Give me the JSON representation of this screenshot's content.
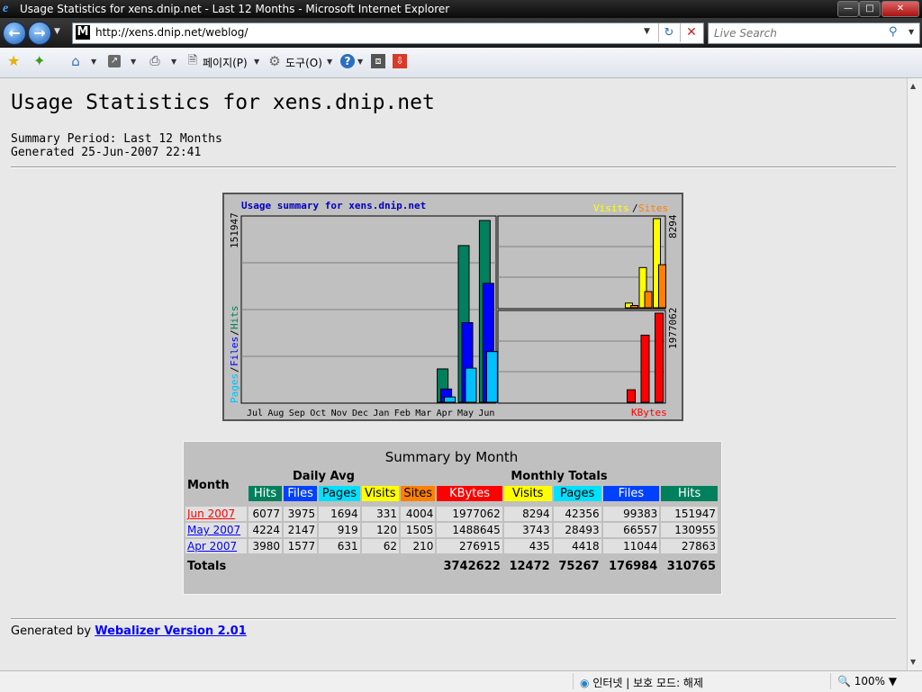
{
  "window": {
    "title": "Usage Statistics for xens.dnip.net - Last 12 Months - Microsoft Internet Explorer"
  },
  "addressbar": {
    "url": "http://xens.dnip.net/weblog/",
    "search_placeholder": "Live Search"
  },
  "commandbar": {
    "page_label": "페이지(P)",
    "tools_label": "도구(O)"
  },
  "page": {
    "heading": "Usage Statistics for xens.dnip.net",
    "summary_period": "Summary Period: Last 12 Months",
    "generated": "Generated 25-Jun-2007 22:41",
    "footer_prefix": "Generated by",
    "footer_link": "Webalizer Version 2.01"
  },
  "chart_data": {
    "type": "bar",
    "title": "Usage summary for xens.dnip.net",
    "categories": [
      "Jul",
      "Aug",
      "Sep",
      "Oct",
      "Nov",
      "Dec",
      "Jan",
      "Feb",
      "Mar",
      "Apr",
      "May",
      "Jun"
    ],
    "series": [
      {
        "name": "Hits",
        "color": "#00805c",
        "values": [
          0,
          0,
          0,
          0,
          0,
          0,
          0,
          0,
          0,
          27863,
          130955,
          151947
        ]
      },
      {
        "name": "Files",
        "color": "#0000ff",
        "values": [
          0,
          0,
          0,
          0,
          0,
          0,
          0,
          0,
          0,
          11044,
          66557,
          99383
        ]
      },
      {
        "name": "Pages",
        "color": "#00c0ff",
        "values": [
          0,
          0,
          0,
          0,
          0,
          0,
          0,
          0,
          0,
          4418,
          28493,
          42356
        ]
      },
      {
        "name": "Visits",
        "color": "#ffff00",
        "values": [
          0,
          0,
          0,
          0,
          0,
          0,
          0,
          0,
          0,
          435,
          3743,
          8294
        ]
      },
      {
        "name": "Sites",
        "color": "#ff8000",
        "values": [
          0,
          0,
          0,
          0,
          0,
          0,
          0,
          0,
          0,
          210,
          1505,
          4004
        ]
      },
      {
        "name": "KBytes",
        "color": "#ff0000",
        "values": [
          0,
          0,
          0,
          0,
          0,
          0,
          0,
          0,
          0,
          276915,
          1488645,
          1977062
        ]
      }
    ],
    "ymax_left_label": "151947",
    "ymax_visits_label": "8294",
    "ymax_kbytes_label": "1977062",
    "left_axis_label": {
      "pages": "Pages",
      "files": "Files",
      "hits": "Hits",
      "sep": "/"
    },
    "visits_sites_label": {
      "visits": "Visits",
      "sites": "Sites",
      "sep": "/"
    },
    "kbytes_label": "KBytes"
  },
  "table": {
    "title": "Summary by Month",
    "month_header": "Month",
    "daily_avg_header": "Daily Avg",
    "monthly_totals_header": "Monthly Totals",
    "daily_cols": [
      {
        "label": "Hits",
        "bg": "#00805c",
        "fg": "#ffffff"
      },
      {
        "label": "Files",
        "bg": "#0040ff",
        "fg": "#ffffff"
      },
      {
        "label": "Pages",
        "bg": "#00e0ff",
        "fg": "#000000"
      },
      {
        "label": "Visits",
        "bg": "#ffff00",
        "fg": "#000000"
      }
    ],
    "monthly_cols": [
      {
        "label": "Sites",
        "bg": "#ff8000",
        "fg": "#000000"
      },
      {
        "label": "KBytes",
        "bg": "#ff0000",
        "fg": "#ffffff"
      },
      {
        "label": "Visits",
        "bg": "#ffff00",
        "fg": "#000000"
      },
      {
        "label": "Pages",
        "bg": "#00e0ff",
        "fg": "#000000"
      },
      {
        "label": "Files",
        "bg": "#0040ff",
        "fg": "#ffffff"
      },
      {
        "label": "Hits",
        "bg": "#00805c",
        "fg": "#ffffff"
      }
    ],
    "rows": [
      {
        "month": "Jun 2007",
        "current": true,
        "vals": [
          "6077",
          "3975",
          "1694",
          "331",
          "4004",
          "1977062",
          "8294",
          "42356",
          "99383",
          "151947"
        ]
      },
      {
        "month": "May 2007",
        "current": false,
        "vals": [
          "4224",
          "2147",
          "919",
          "120",
          "1505",
          "1488645",
          "3743",
          "28493",
          "66557",
          "130955"
        ]
      },
      {
        "month": "Apr 2007",
        "current": false,
        "vals": [
          "3980",
          "1577",
          "631",
          "62",
          "210",
          "276915",
          "435",
          "4418",
          "11044",
          "27863"
        ]
      }
    ],
    "totals_label": "Totals",
    "totals": [
      "3742622",
      "12472",
      "75267",
      "176984",
      "310765"
    ]
  },
  "statusbar": {
    "zone": "인터넷 | 보호 모드: 해제",
    "zoom": "100%"
  }
}
